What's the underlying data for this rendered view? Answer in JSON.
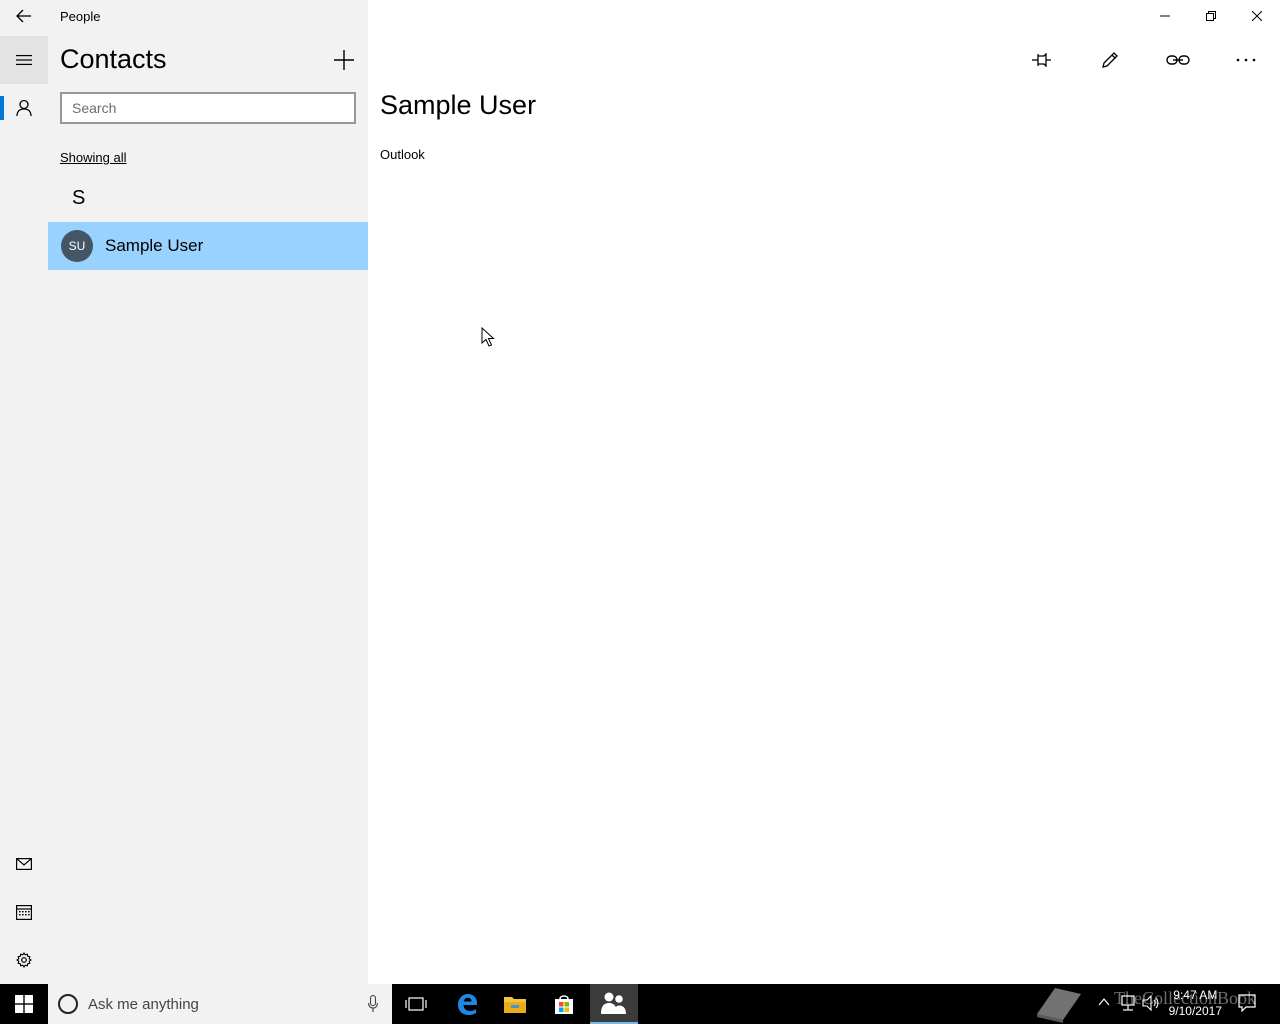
{
  "titlebar": {
    "app_title": "People"
  },
  "list_pane": {
    "title": "Contacts",
    "search_placeholder": "Search",
    "filter_label": "Showing all",
    "group_header": "S",
    "contacts": [
      {
        "initials": "SU",
        "name": "Sample User",
        "selected": true
      }
    ]
  },
  "detail": {
    "name": "Sample User",
    "source": "Outlook"
  },
  "taskbar": {
    "search_placeholder": "Ask me anything",
    "clock_time": "9:47 AM",
    "clock_date": "9/10/2017",
    "watermark": "TheCollectionBook"
  },
  "colors": {
    "accent": "#0078d7",
    "selected_item": "#99d1ff",
    "pane_bg": "#f2f2f2",
    "avatar_bg": "#445566"
  },
  "icons": [
    "back-arrow-icon",
    "hamburger-icon",
    "person-icon",
    "mail-icon",
    "calendar-icon",
    "gear-icon",
    "plus-icon",
    "pin-icon",
    "pencil-icon",
    "link-icon",
    "more-icon",
    "minimize-icon",
    "restore-icon",
    "close-icon",
    "windows-logo-icon",
    "microphone-icon",
    "task-view-icon",
    "edge-icon",
    "file-explorer-icon",
    "store-icon",
    "people-icon"
  ]
}
